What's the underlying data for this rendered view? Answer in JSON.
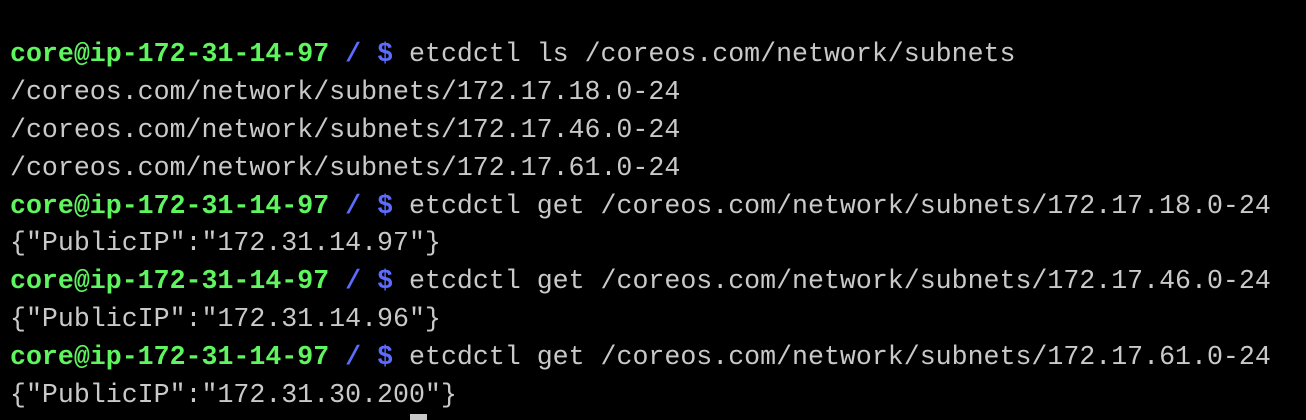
{
  "prompt": {
    "user_host": "core@ip-172-31-14-97",
    "cwd": "/",
    "symbol": "$"
  },
  "colors": {
    "background": "#000000",
    "prompt_user": "#5ff55f",
    "prompt_path": "#5c6cff",
    "text": "#c9c9c9"
  },
  "lines": [
    {
      "type": "command",
      "text": "etcdctl ls /coreos.com/network/subnets"
    },
    {
      "type": "output",
      "text": "/coreos.com/network/subnets/172.17.18.0-24"
    },
    {
      "type": "output",
      "text": "/coreos.com/network/subnets/172.17.46.0-24"
    },
    {
      "type": "output",
      "text": "/coreos.com/network/subnets/172.17.61.0-24"
    },
    {
      "type": "command",
      "text": "etcdctl get /coreos.com/network/subnets/172.17.18.0-24"
    },
    {
      "type": "output",
      "text": "{\"PublicIP\":\"172.31.14.97\"}"
    },
    {
      "type": "command",
      "text": "etcdctl get /coreos.com/network/subnets/172.17.46.0-24"
    },
    {
      "type": "output",
      "text": "{\"PublicIP\":\"172.31.14.96\"}"
    },
    {
      "type": "command",
      "text": "etcdctl get /coreos.com/network/subnets/172.17.61.0-24"
    },
    {
      "type": "output",
      "text": "{\"PublicIP\":\"172.31.30.200\"}"
    }
  ]
}
